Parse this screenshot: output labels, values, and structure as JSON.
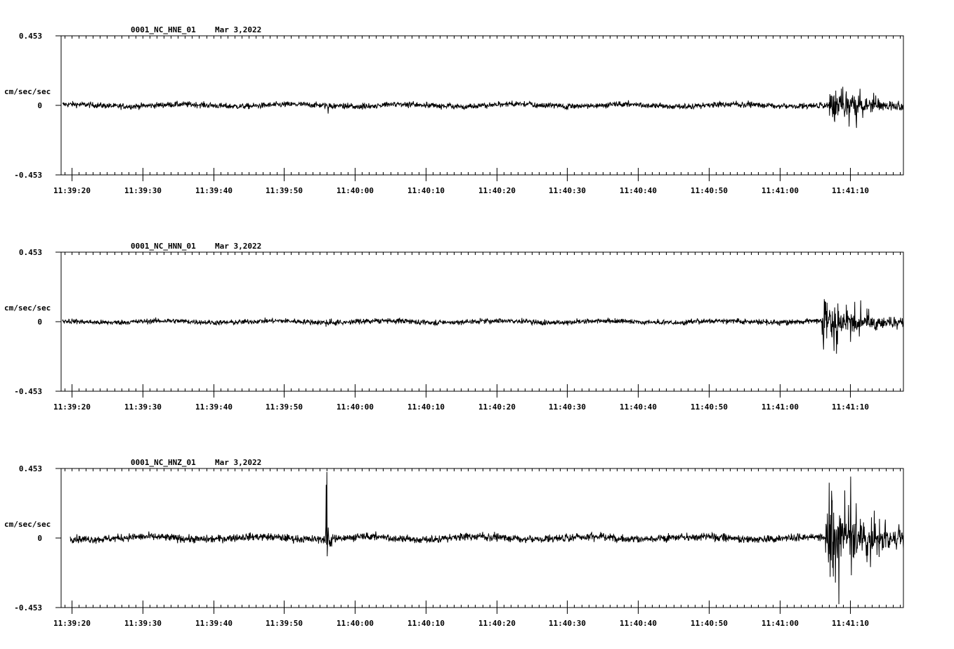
{
  "chart_data": [
    {
      "type": "line",
      "title": "0001_NC_HNE_01",
      "date": "Mar 3,2022",
      "ylabel": "cm/sec/sec",
      "yticks": [
        "0.453",
        "0",
        "-0.453"
      ],
      "ylim": [
        -0.453,
        0.453
      ],
      "xticks": [
        "11:39:20",
        "11:39:30",
        "11:39:40",
        "11:39:50",
        "11:40:00",
        "11:40:10",
        "11:40:20",
        "11:40:30",
        "11:40:40",
        "11:40:50",
        "11:41:00",
        "11:41:10"
      ],
      "xlim_seconds_of_day": [
        41958.5,
        42077.5
      ],
      "trace": {
        "start": 41958.7,
        "end": 42077.5,
        "noise": 0.018,
        "events": [
          {
            "t": 41995.9,
            "amp": 0.07,
            "decay": 0.6
          },
          {
            "t": 42067.0,
            "amp": 0.2,
            "decay": 5.0
          }
        ]
      }
    },
    {
      "type": "line",
      "title": "0001_NC_HNN_01",
      "date": "Mar 3,2022",
      "ylabel": "cm/sec/sec",
      "yticks": [
        "0.453",
        "0",
        "-0.453"
      ],
      "ylim": [
        -0.453,
        0.453
      ],
      "xticks": [
        "11:39:20",
        "11:39:30",
        "11:39:40",
        "11:39:50",
        "11:40:00",
        "11:40:10",
        "11:40:20",
        "11:40:30",
        "11:40:40",
        "11:40:50",
        "11:41:00",
        "11:41:10"
      ],
      "xlim_seconds_of_day": [
        41958.5,
        42077.5
      ],
      "trace": {
        "start": 41958.7,
        "end": 42077.5,
        "noise": 0.016,
        "events": [
          {
            "t": 41995.9,
            "amp": 0.06,
            "decay": 0.6
          },
          {
            "t": 42066.0,
            "amp": 0.22,
            "decay": 6.0
          }
        ]
      }
    },
    {
      "type": "line",
      "title": "0001_NC_HNZ_01",
      "date": "Mar 3,2022",
      "ylabel": "cm/sec/sec",
      "yticks": [
        "0.453",
        "0",
        "-0.453"
      ],
      "ylim": [
        -0.453,
        0.453
      ],
      "xticks": [
        "11:39:20",
        "11:39:30",
        "11:39:40",
        "11:39:50",
        "11:40:00",
        "11:40:10",
        "11:40:20",
        "11:40:30",
        "11:40:40",
        "11:40:50",
        "11:41:00",
        "11:41:10"
      ],
      "xlim_seconds_of_day": [
        41958.5,
        42077.5
      ],
      "trace": {
        "start": 41959.8,
        "end": 42077.5,
        "noise": 0.024,
        "events": [
          {
            "t": 41995.8,
            "amp": 0.45,
            "decay": 0.45
          },
          {
            "t": 42066.5,
            "amp": 0.38,
            "decay": 6.0
          }
        ]
      }
    }
  ]
}
